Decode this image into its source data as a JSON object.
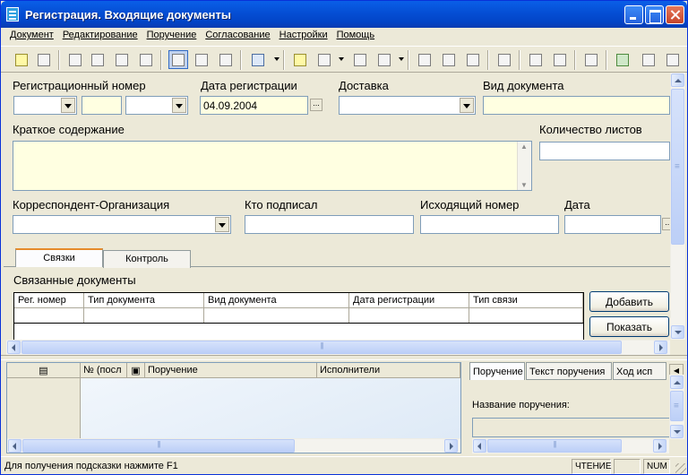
{
  "window": {
    "title": "Регистрация. Входящие документы"
  },
  "menu": {
    "items": [
      "Документ",
      "Редактирование",
      "Поручение",
      "Согласование",
      "Настройки",
      "Помощь"
    ]
  },
  "toolbar": {
    "icons": [
      "new-document-icon",
      "save-icon",
      "undo-icon",
      "tools-icon",
      "align-icon",
      "cut-icon",
      "attach-icon",
      "stamp-icon",
      "forward-icon",
      "route-icon",
      "note-icon",
      "copy-icon",
      "sign-icon",
      "pin-icon",
      "doc-icon",
      "doc2-icon",
      "doc3-icon",
      "envelope-icon",
      "approve-icon",
      "folder-icon",
      "print-icon",
      "map-icon",
      "key-icon",
      "exit-icon"
    ]
  },
  "form": {
    "reg_number_label": "Регистрационный номер",
    "reg_date_label": "Дата регистрации",
    "reg_date_value": "04.09.2004",
    "ellipsis": "...",
    "delivery_label": "Доставка",
    "doc_kind_label": "Вид документа",
    "summary_label": "Краткое содержание",
    "sheets_label": "Количество листов",
    "correspondent_label": "Корреспондент-Организация",
    "signed_label": "Кто подписал",
    "outgoing_label": "Исходящий номер",
    "date_label": "Дата"
  },
  "tabs": {
    "items": [
      "Связки",
      "Контроль"
    ],
    "active": "Связки"
  },
  "linked": {
    "title": "Связанные документы",
    "columns": [
      "Рег. номер",
      "Тип документа",
      "Вид документа",
      "Дата регистрации",
      "Тип связи"
    ],
    "add_label": "Добавить",
    "show_label": "Показать"
  },
  "assignments": {
    "columns": [
      "№ (посл",
      "Поручение",
      "Исполнители"
    ]
  },
  "right_panel": {
    "tabs": [
      "Поручение",
      "Текст поручения",
      "Ход исп"
    ],
    "assignment_name_label": "Название поручения:"
  },
  "status": {
    "hint": "Для получения подсказки нажмите F1",
    "mode": "ЧТЕНИЕ",
    "num": "NUM"
  }
}
